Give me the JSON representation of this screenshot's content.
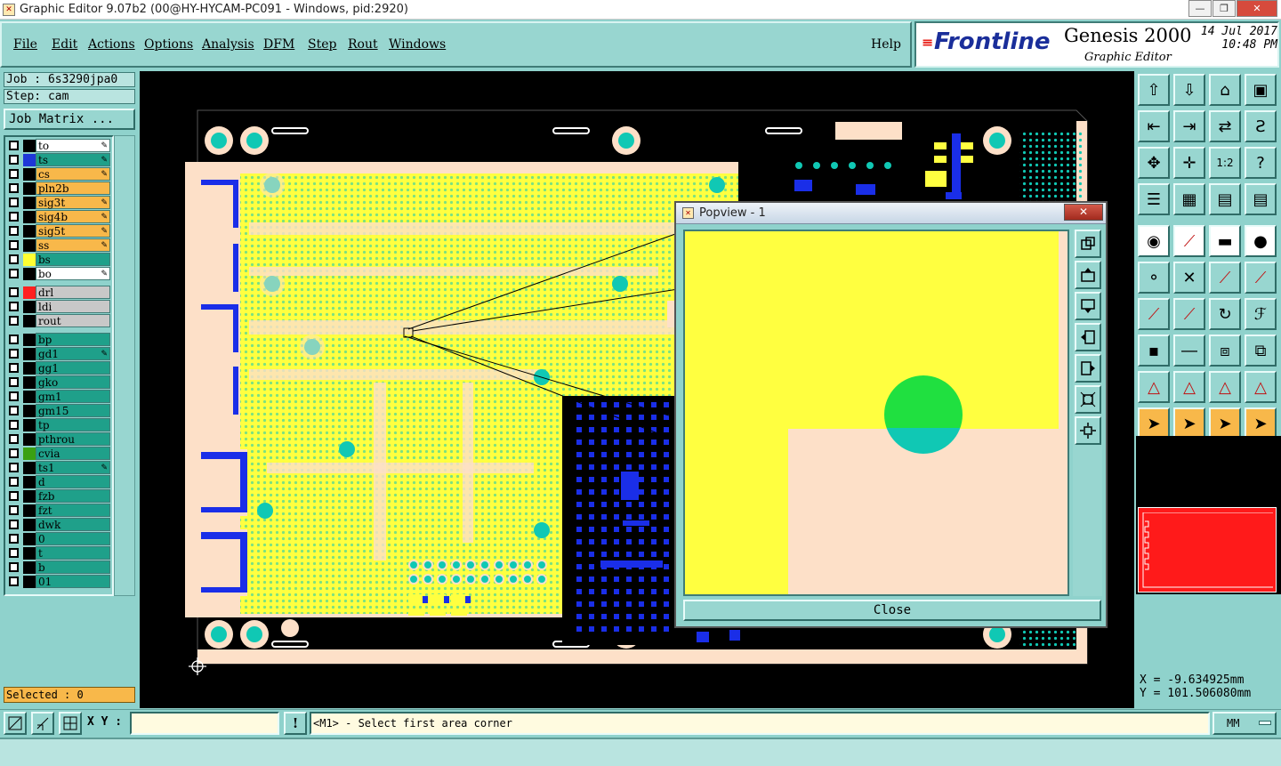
{
  "window": {
    "title": "Graphic Editor 9.07b2 (00@HY-HYCAM-PC091 - Windows, pid:2920)",
    "min": "—",
    "max": "❐",
    "close": "✕"
  },
  "menu": {
    "items": [
      "File",
      "Edit",
      "Actions",
      "Options",
      "Analysis",
      "DFM",
      "Step",
      "Rout",
      "Windows"
    ],
    "help": "Help"
  },
  "brand": {
    "logo": "Frontline",
    "product": "Genesis 2000",
    "subtitle": "Graphic Editor",
    "date": "14 Jul 2017",
    "time": "10:48 PM"
  },
  "job": {
    "job_label": "Job : 6s3290jpa0",
    "step_label": "Step: cam",
    "matrix_button": "Job Matrix ..."
  },
  "layers": [
    {
      "name": "to",
      "bg": "#ffffff",
      "swatch": "#000000",
      "edit": true
    },
    {
      "name": "ts",
      "bg": "#1fa08a",
      "swatch": "#1f37d8",
      "edit": true
    },
    {
      "name": "cs",
      "bg": "#f8b84a",
      "swatch": "#000000",
      "edit": true
    },
    {
      "name": "pln2b",
      "bg": "#f8b84a",
      "swatch": "#000000",
      "edit": false
    },
    {
      "name": "sig3t",
      "bg": "#f8b84a",
      "swatch": "#000000",
      "edit": true
    },
    {
      "name": "sig4b",
      "bg": "#f8b84a",
      "swatch": "#000000",
      "edit": true
    },
    {
      "name": "sig5t",
      "bg": "#f8b84a",
      "swatch": "#000000",
      "edit": true
    },
    {
      "name": "ss",
      "bg": "#f8b84a",
      "swatch": "#000000",
      "edit": true
    },
    {
      "name": "bs",
      "bg": "#1fa08a",
      "swatch": "#ffff33",
      "edit": false
    },
    {
      "name": "bo",
      "bg": "#ffffff",
      "swatch": "#000000",
      "edit": true
    },
    {
      "name": "drl",
      "bg": "#c8c8c8",
      "swatch": "#ff2020",
      "edit": false
    },
    {
      "name": "ldi",
      "bg": "#c8c8c8",
      "swatch": "#000000",
      "edit": false
    },
    {
      "name": "rout",
      "bg": "#c8c8c8",
      "swatch": "#000000",
      "edit": false
    },
    {
      "name": "bp",
      "bg": "#1fa08a",
      "swatch": "#000000",
      "edit": false
    },
    {
      "name": "gd1",
      "bg": "#1fa08a",
      "swatch": "#000000",
      "edit": true
    },
    {
      "name": "gg1",
      "bg": "#1fa08a",
      "swatch": "#000000",
      "edit": false
    },
    {
      "name": "gko",
      "bg": "#1fa08a",
      "swatch": "#000000",
      "edit": false
    },
    {
      "name": "gm1",
      "bg": "#1fa08a",
      "swatch": "#000000",
      "edit": false
    },
    {
      "name": "gm15",
      "bg": "#1fa08a",
      "swatch": "#000000",
      "edit": false
    },
    {
      "name": "tp",
      "bg": "#1fa08a",
      "swatch": "#000000",
      "edit": false
    },
    {
      "name": "pthrou",
      "bg": "#1fa08a",
      "swatch": "#000000",
      "edit": false
    },
    {
      "name": "cvia",
      "bg": "#1fa08a",
      "swatch": "#3aa012",
      "edit": false
    },
    {
      "name": "ts1",
      "bg": "#1fa08a",
      "swatch": "#000000",
      "edit": true
    },
    {
      "name": "d",
      "bg": "#1fa08a",
      "swatch": "#000000",
      "edit": false
    },
    {
      "name": "fzb",
      "bg": "#1fa08a",
      "swatch": "#000000",
      "edit": false
    },
    {
      "name": "fzt",
      "bg": "#1fa08a",
      "swatch": "#000000",
      "edit": false
    },
    {
      "name": "dwk",
      "bg": "#1fa08a",
      "swatch": "#000000",
      "edit": false
    },
    {
      "name": "0",
      "bg": "#1fa08a",
      "swatch": "#000000",
      "edit": false
    },
    {
      "name": "t",
      "bg": "#1fa08a",
      "swatch": "#000000",
      "edit": false
    },
    {
      "name": "b",
      "bg": "#1fa08a",
      "swatch": "#000000",
      "edit": false
    },
    {
      "name": "01",
      "bg": "#1fa08a",
      "swatch": "#000000",
      "edit": false
    }
  ],
  "selected_label": "Selected : 0",
  "popview": {
    "title": "Popview - 1",
    "close_button": "Close"
  },
  "coords": {
    "x": "X = -9.634925mm",
    "y": "Y = 101.506080mm"
  },
  "status": {
    "xy_label": "X Y :",
    "xy_value": "",
    "message": "<M1> - Select first area corner",
    "units": "MM"
  },
  "colors": {
    "board": "#fde0c8",
    "copper": "#ffff40",
    "pad": "#10c8b4",
    "smd": "#1a2ee8",
    "panel": "#8fd2cc"
  }
}
